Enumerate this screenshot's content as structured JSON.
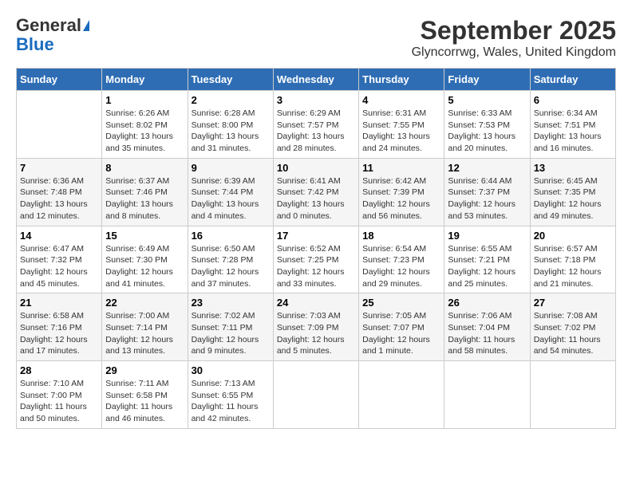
{
  "header": {
    "logo_line1": "General",
    "logo_line2": "Blue",
    "month": "September 2025",
    "location": "Glyncorrwg, Wales, United Kingdom"
  },
  "weekdays": [
    "Sunday",
    "Monday",
    "Tuesday",
    "Wednesday",
    "Thursday",
    "Friday",
    "Saturday"
  ],
  "weeks": [
    [
      {
        "day": "",
        "info": ""
      },
      {
        "day": "1",
        "info": "Sunrise: 6:26 AM\nSunset: 8:02 PM\nDaylight: 13 hours\nand 35 minutes."
      },
      {
        "day": "2",
        "info": "Sunrise: 6:28 AM\nSunset: 8:00 PM\nDaylight: 13 hours\nand 31 minutes."
      },
      {
        "day": "3",
        "info": "Sunrise: 6:29 AM\nSunset: 7:57 PM\nDaylight: 13 hours\nand 28 minutes."
      },
      {
        "day": "4",
        "info": "Sunrise: 6:31 AM\nSunset: 7:55 PM\nDaylight: 13 hours\nand 24 minutes."
      },
      {
        "day": "5",
        "info": "Sunrise: 6:33 AM\nSunset: 7:53 PM\nDaylight: 13 hours\nand 20 minutes."
      },
      {
        "day": "6",
        "info": "Sunrise: 6:34 AM\nSunset: 7:51 PM\nDaylight: 13 hours\nand 16 minutes."
      }
    ],
    [
      {
        "day": "7",
        "info": "Sunrise: 6:36 AM\nSunset: 7:48 PM\nDaylight: 13 hours\nand 12 minutes."
      },
      {
        "day": "8",
        "info": "Sunrise: 6:37 AM\nSunset: 7:46 PM\nDaylight: 13 hours\nand 8 minutes."
      },
      {
        "day": "9",
        "info": "Sunrise: 6:39 AM\nSunset: 7:44 PM\nDaylight: 13 hours\nand 4 minutes."
      },
      {
        "day": "10",
        "info": "Sunrise: 6:41 AM\nSunset: 7:42 PM\nDaylight: 13 hours\nand 0 minutes."
      },
      {
        "day": "11",
        "info": "Sunrise: 6:42 AM\nSunset: 7:39 PM\nDaylight: 12 hours\nand 56 minutes."
      },
      {
        "day": "12",
        "info": "Sunrise: 6:44 AM\nSunset: 7:37 PM\nDaylight: 12 hours\nand 53 minutes."
      },
      {
        "day": "13",
        "info": "Sunrise: 6:45 AM\nSunset: 7:35 PM\nDaylight: 12 hours\nand 49 minutes."
      }
    ],
    [
      {
        "day": "14",
        "info": "Sunrise: 6:47 AM\nSunset: 7:32 PM\nDaylight: 12 hours\nand 45 minutes."
      },
      {
        "day": "15",
        "info": "Sunrise: 6:49 AM\nSunset: 7:30 PM\nDaylight: 12 hours\nand 41 minutes."
      },
      {
        "day": "16",
        "info": "Sunrise: 6:50 AM\nSunset: 7:28 PM\nDaylight: 12 hours\nand 37 minutes."
      },
      {
        "day": "17",
        "info": "Sunrise: 6:52 AM\nSunset: 7:25 PM\nDaylight: 12 hours\nand 33 minutes."
      },
      {
        "day": "18",
        "info": "Sunrise: 6:54 AM\nSunset: 7:23 PM\nDaylight: 12 hours\nand 29 minutes."
      },
      {
        "day": "19",
        "info": "Sunrise: 6:55 AM\nSunset: 7:21 PM\nDaylight: 12 hours\nand 25 minutes."
      },
      {
        "day": "20",
        "info": "Sunrise: 6:57 AM\nSunset: 7:18 PM\nDaylight: 12 hours\nand 21 minutes."
      }
    ],
    [
      {
        "day": "21",
        "info": "Sunrise: 6:58 AM\nSunset: 7:16 PM\nDaylight: 12 hours\nand 17 minutes."
      },
      {
        "day": "22",
        "info": "Sunrise: 7:00 AM\nSunset: 7:14 PM\nDaylight: 12 hours\nand 13 minutes."
      },
      {
        "day": "23",
        "info": "Sunrise: 7:02 AM\nSunset: 7:11 PM\nDaylight: 12 hours\nand 9 minutes."
      },
      {
        "day": "24",
        "info": "Sunrise: 7:03 AM\nSunset: 7:09 PM\nDaylight: 12 hours\nand 5 minutes."
      },
      {
        "day": "25",
        "info": "Sunrise: 7:05 AM\nSunset: 7:07 PM\nDaylight: 12 hours\nand 1 minute."
      },
      {
        "day": "26",
        "info": "Sunrise: 7:06 AM\nSunset: 7:04 PM\nDaylight: 11 hours\nand 58 minutes."
      },
      {
        "day": "27",
        "info": "Sunrise: 7:08 AM\nSunset: 7:02 PM\nDaylight: 11 hours\nand 54 minutes."
      }
    ],
    [
      {
        "day": "28",
        "info": "Sunrise: 7:10 AM\nSunset: 7:00 PM\nDaylight: 11 hours\nand 50 minutes."
      },
      {
        "day": "29",
        "info": "Sunrise: 7:11 AM\nSunset: 6:58 PM\nDaylight: 11 hours\nand 46 minutes."
      },
      {
        "day": "30",
        "info": "Sunrise: 7:13 AM\nSunset: 6:55 PM\nDaylight: 11 hours\nand 42 minutes."
      },
      {
        "day": "",
        "info": ""
      },
      {
        "day": "",
        "info": ""
      },
      {
        "day": "",
        "info": ""
      },
      {
        "day": "",
        "info": ""
      }
    ]
  ]
}
